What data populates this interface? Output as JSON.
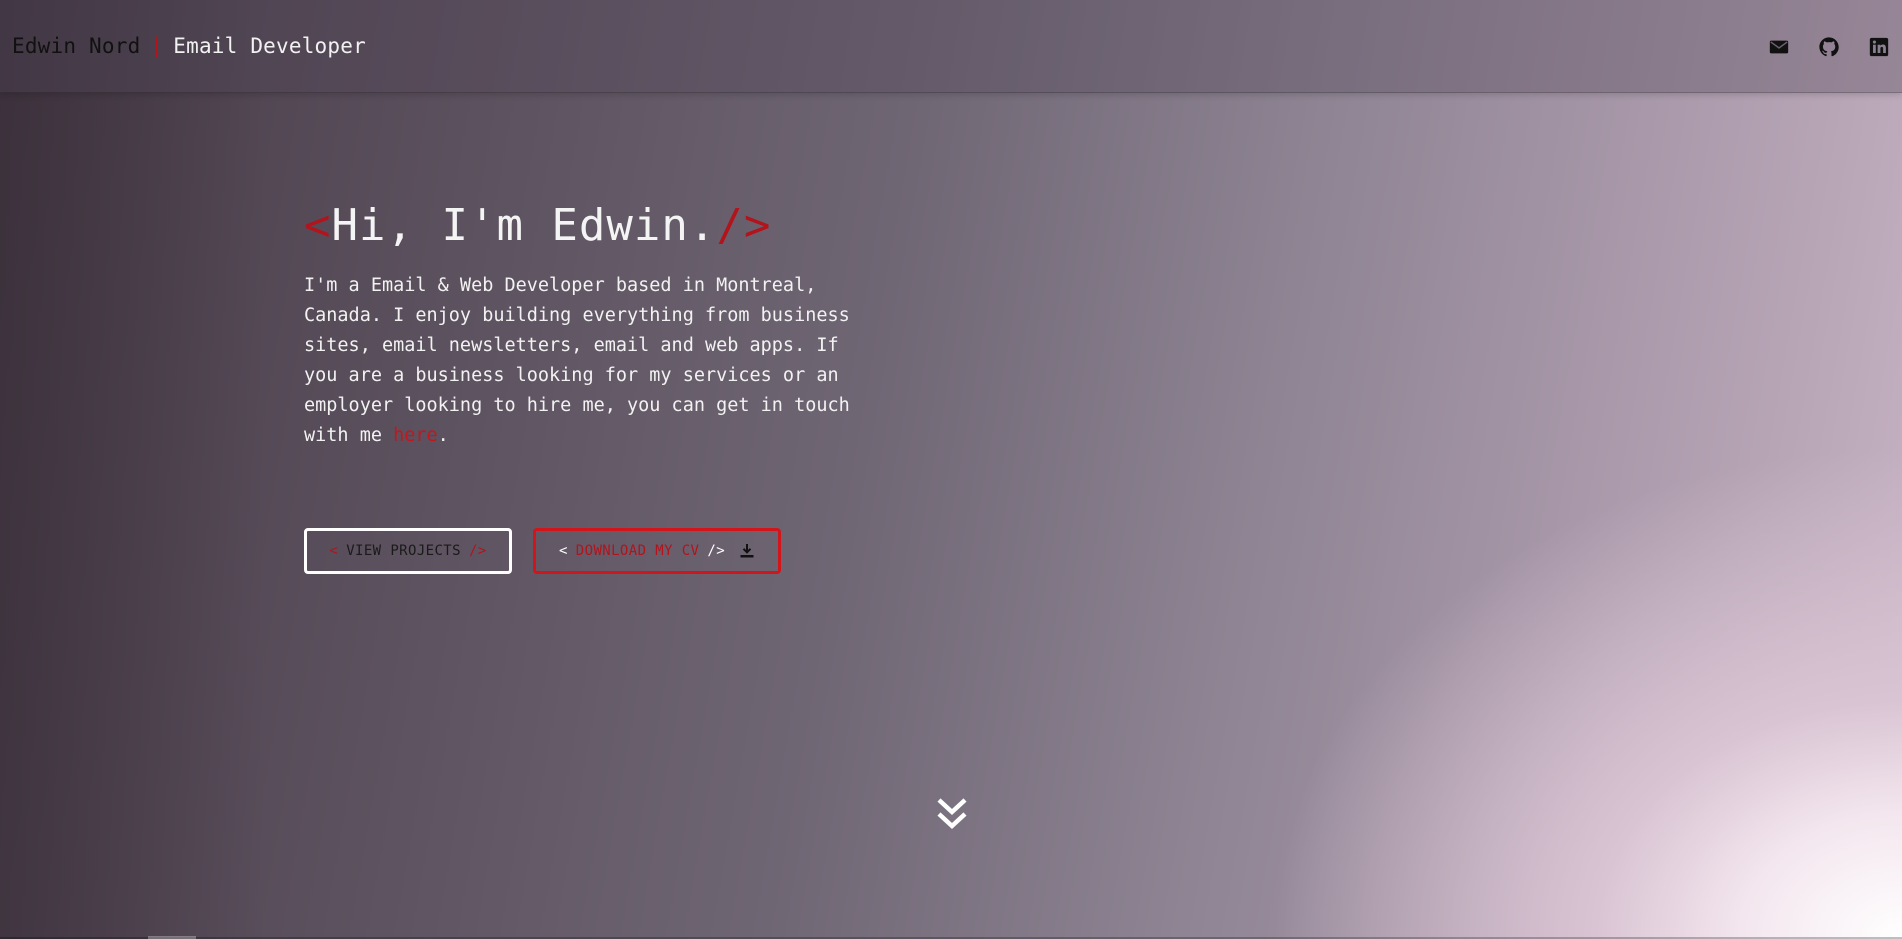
{
  "header": {
    "name": "Edwin Nord",
    "separator": "|",
    "role": "Email Developer",
    "social": [
      {
        "icon": "envelope-icon"
      },
      {
        "icon": "github-icon"
      },
      {
        "icon": "linkedin-icon"
      }
    ]
  },
  "hero": {
    "title_open": "<",
    "title": "Hi, I'm Edwin.",
    "title_close": "/>",
    "intro_text": "I'm a Email & Web Developer based in Montreal, Canada. I enjoy building everything from business sites, email newsletters, email and web apps. If you are a business looking for my services or an employer looking to hire me, you can get in touch with me ",
    "intro_link": "here",
    "intro_end": "."
  },
  "buttons": {
    "projects": {
      "open": "<",
      "label": "VIEW PROJECTS",
      "close": "/>"
    },
    "cv": {
      "open": "<",
      "label": "DOWNLOAD MY CV",
      "close": "/>",
      "icon": "download-icon"
    }
  },
  "scroll": {
    "icon": "double-chevron-down-icon"
  },
  "colors": {
    "accent": "#b3131b",
    "text": "#f2f2f2"
  }
}
